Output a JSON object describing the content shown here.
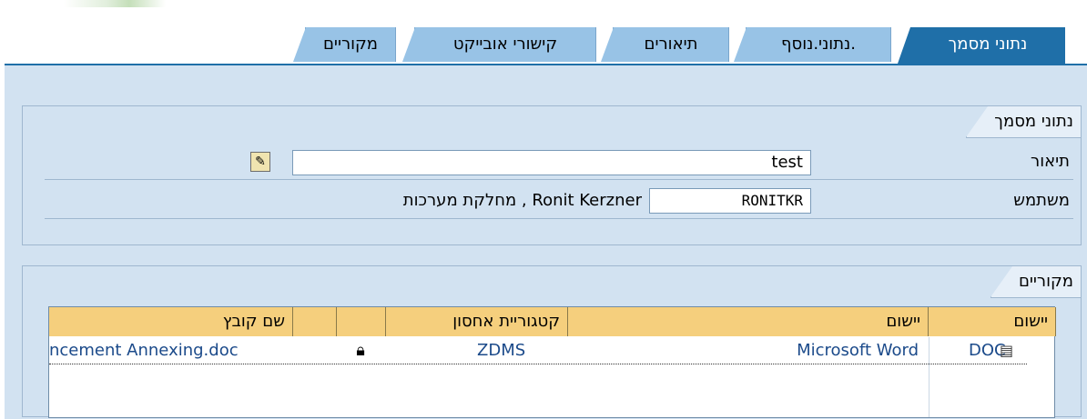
{
  "tabs": [
    {
      "label": "נתוני מסמך",
      "active": true
    },
    {
      "label": "נתוני.נוסף."
    },
    {
      "label": "תיאורים"
    },
    {
      "label": "קישורי אובייקט"
    },
    {
      "label": "מקוריים"
    }
  ],
  "document_group": {
    "title": "נתוני מסמך",
    "description_label": "תיאור",
    "description_value": "test",
    "user_label": "משתמש",
    "user_value": "RONITKR",
    "user_name": "Ronit Kerzner , מחלקת מערכות"
  },
  "originals_group": {
    "title": "מקוריים",
    "columns": [
      "יישום",
      "יישום",
      "קטגוריית אחסון",
      "",
      "",
      "שם קובץ"
    ],
    "rows": [
      {
        "app_code": "DOC",
        "app_name": "Microsoft Word",
        "storage_category": "ZDMS",
        "file_name": "ncement Annexing.doc"
      }
    ]
  },
  "icons": {
    "edit": "pencil-edit-icon",
    "lock": "padlock-icon",
    "doc": "document-icon"
  },
  "colors": {
    "active_tab": "#1f6fa8",
    "tab": "#98c3e6",
    "panel": "#d2e2f1",
    "grid_header": "#f5cf7d",
    "link_text": "#1b4a8a"
  }
}
